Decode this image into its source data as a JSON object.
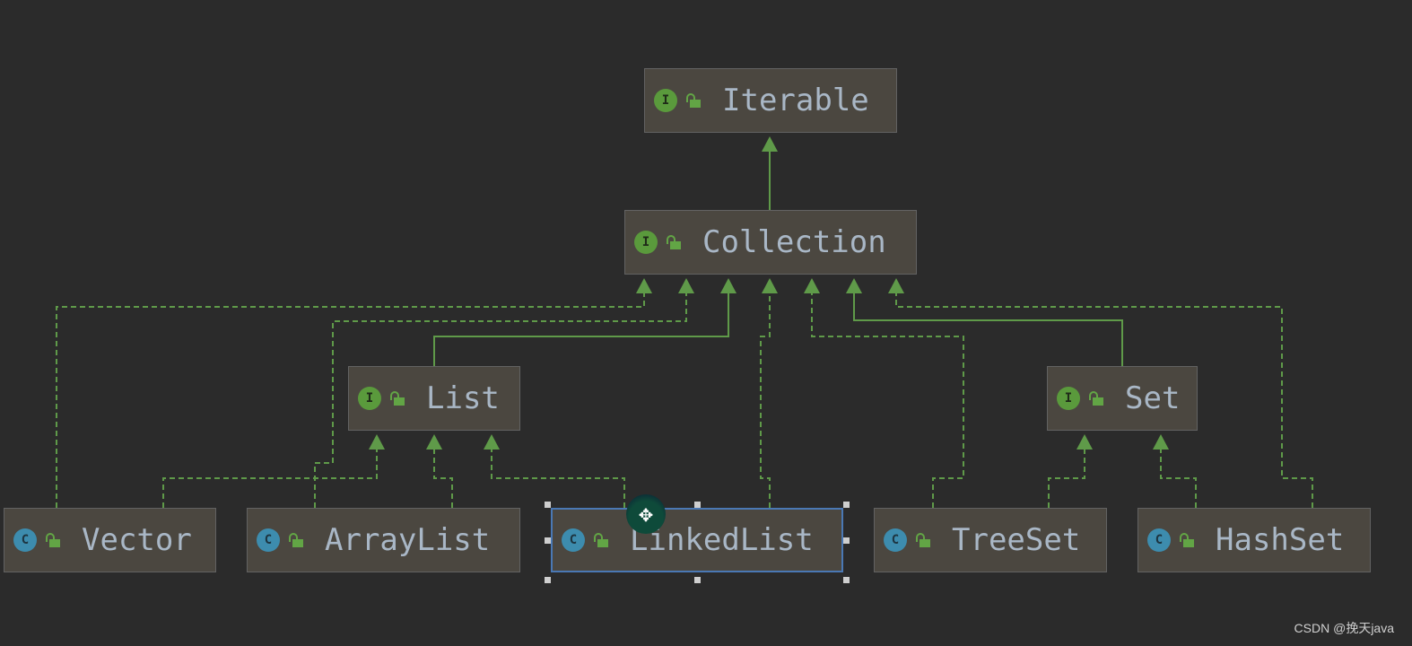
{
  "colors": {
    "background": "#2b2b2b",
    "node_fill": "#4b4740",
    "text": "#a9b7c6",
    "edge": "#5f9a49",
    "interface_badge": "#5a9a3c",
    "class_badge": "#3d8cae",
    "selection": "#4a78b4"
  },
  "nodes": [
    {
      "id": "Iterable",
      "label": "Iterable",
      "kind": "interface",
      "badge": "I"
    },
    {
      "id": "Collection",
      "label": "Collection",
      "kind": "interface",
      "badge": "I"
    },
    {
      "id": "List",
      "label": "List",
      "kind": "interface",
      "badge": "I"
    },
    {
      "id": "Set",
      "label": "Set",
      "kind": "interface",
      "badge": "I"
    },
    {
      "id": "Vector",
      "label": "Vector",
      "kind": "class",
      "badge": "C"
    },
    {
      "id": "ArrayList",
      "label": "ArrayList",
      "kind": "class",
      "badge": "C"
    },
    {
      "id": "LinkedList",
      "label": "LinkedList",
      "kind": "class",
      "badge": "C",
      "selected": true
    },
    {
      "id": "TreeSet",
      "label": "TreeSet",
      "kind": "class",
      "badge": "C"
    },
    {
      "id": "HashSet",
      "label": "HashSet",
      "kind": "class",
      "badge": "C"
    }
  ],
  "edges": [
    {
      "from": "Collection",
      "to": "Iterable",
      "type": "extends"
    },
    {
      "from": "Vector",
      "to": "Collection",
      "type": "implements"
    },
    {
      "from": "ArrayList",
      "to": "Collection",
      "type": "implements"
    },
    {
      "from": "List",
      "to": "Collection",
      "type": "extends"
    },
    {
      "from": "LinkedList",
      "to": "Collection",
      "type": "implements"
    },
    {
      "from": "TreeSet",
      "to": "Collection",
      "type": "implements"
    },
    {
      "from": "Set",
      "to": "Collection",
      "type": "extends"
    },
    {
      "from": "HashSet",
      "to": "Collection",
      "type": "implements"
    },
    {
      "from": "Vector",
      "to": "List",
      "type": "implements"
    },
    {
      "from": "ArrayList",
      "to": "List",
      "type": "implements"
    },
    {
      "from": "LinkedList",
      "to": "List",
      "type": "implements"
    },
    {
      "from": "TreeSet",
      "to": "Set",
      "type": "implements"
    },
    {
      "from": "HashSet",
      "to": "Set",
      "type": "implements"
    }
  ],
  "watermark": "CSDN @挽天java"
}
